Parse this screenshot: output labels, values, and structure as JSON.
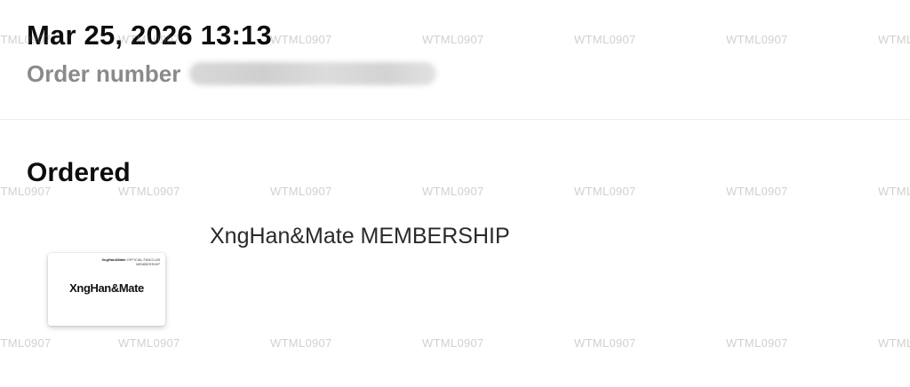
{
  "order": {
    "date": "Mar 25, 2026 13:13",
    "number_label": "Order number",
    "number_value": "••••••••••••••••"
  },
  "ordered": {
    "title": "Ordered",
    "items": [
      {
        "name": "XngHan&Mate MEMBERSHIP",
        "thumbnail": {
          "logo_text": "XngHan&Mate",
          "small_brand": "XngHan&Mate",
          "small_line1": "OFFICIAL FANCLUB",
          "small_line2": "MEMBERSHIP"
        }
      }
    ]
  },
  "watermark": {
    "text": "WTML0907"
  },
  "colors": {
    "text_primary": "#0d0d0d",
    "text_secondary": "#8a8a8a",
    "divider": "#ececec",
    "background": "#ffffff"
  }
}
